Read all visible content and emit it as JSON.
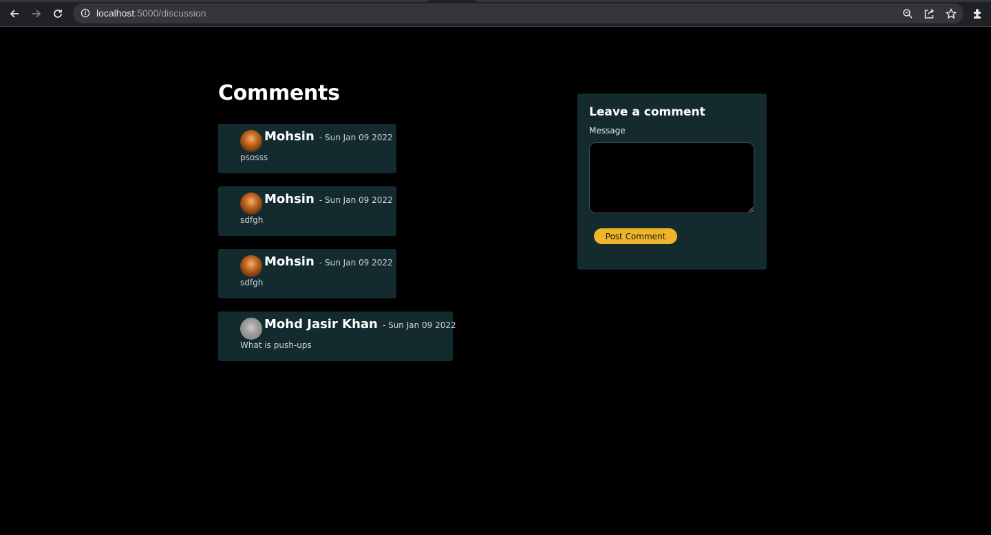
{
  "browser": {
    "url_host": "localhost",
    "url_path": ":5000/discussion"
  },
  "page": {
    "comments_title": "Comments",
    "comments": [
      {
        "author": "Mohsin",
        "date": "- Sun Jan 09 2022",
        "message": "psosss",
        "avatar": "brown"
      },
      {
        "author": "Mohsin",
        "date": "- Sun Jan 09 2022",
        "message": "sdfgh",
        "avatar": "brown"
      },
      {
        "author": "Mohsin",
        "date": "- Sun Jan 09 2022",
        "message": "sdfgh",
        "avatar": "brown"
      },
      {
        "author": "Mohd Jasir Khan",
        "date": "- Sun Jan 09 2022",
        "message": "What is push-ups",
        "avatar": "gray"
      }
    ]
  },
  "form": {
    "title": "Leave a comment",
    "message_label": "Message",
    "message_value": "",
    "button_label": "Post Comment"
  },
  "colors": {
    "accent": "#f0b429",
    "card_bg": "#132b2f",
    "page_bg": "#000000"
  }
}
